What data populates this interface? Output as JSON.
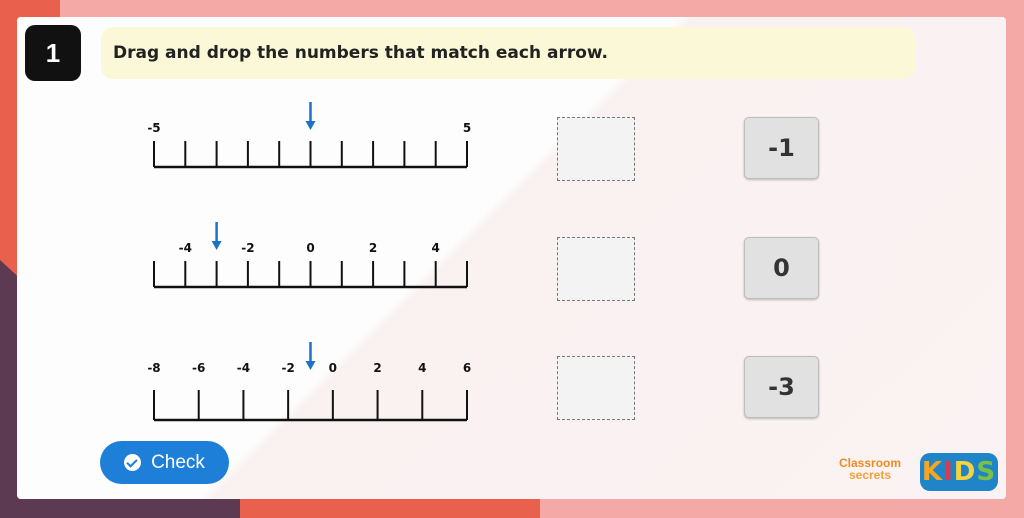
{
  "question": {
    "number": "1",
    "instruction": "Drag and drop the numbers that match each arrow."
  },
  "number_lines": [
    {
      "labels": [
        {
          "text": "-5",
          "tick": 0
        },
        {
          "text": "5",
          "tick": 10
        }
      ],
      "tick_count": 11,
      "arrow_tick": 5
    },
    {
      "labels": [
        {
          "text": "-4",
          "tick": 1
        },
        {
          "text": "-2",
          "tick": 3
        },
        {
          "text": "0",
          "tick": 5
        },
        {
          "text": "2",
          "tick": 7
        },
        {
          "text": "4",
          "tick": 9
        }
      ],
      "tick_count": 11,
      "arrow_tick": 2
    },
    {
      "labels": [
        {
          "text": "-8",
          "tick": 0
        },
        {
          "text": "-6",
          "tick": 1
        },
        {
          "text": "-4",
          "tick": 2
        },
        {
          "text": "-2",
          "tick": 3
        },
        {
          "text": "0",
          "tick": 4
        },
        {
          "text": "2",
          "tick": 5
        },
        {
          "text": "4",
          "tick": 6
        },
        {
          "text": "6",
          "tick": 7
        }
      ],
      "tick_count": 8,
      "arrow_tick": 3.5
    }
  ],
  "answer_tiles": [
    "-1",
    "0",
    "-3"
  ],
  "check_button": {
    "label": "Check"
  },
  "branding": {
    "line1": "Classroom",
    "line2": "secrets",
    "kids": "KIDS"
  },
  "colors": {
    "arrow": "#1a73c9",
    "check_button": "#1e7fd9",
    "instruction_bg": "#fbf8d7",
    "kids_letters": [
      "#f6a623",
      "#e0394b",
      "#f6d33c",
      "#7ac143"
    ]
  }
}
